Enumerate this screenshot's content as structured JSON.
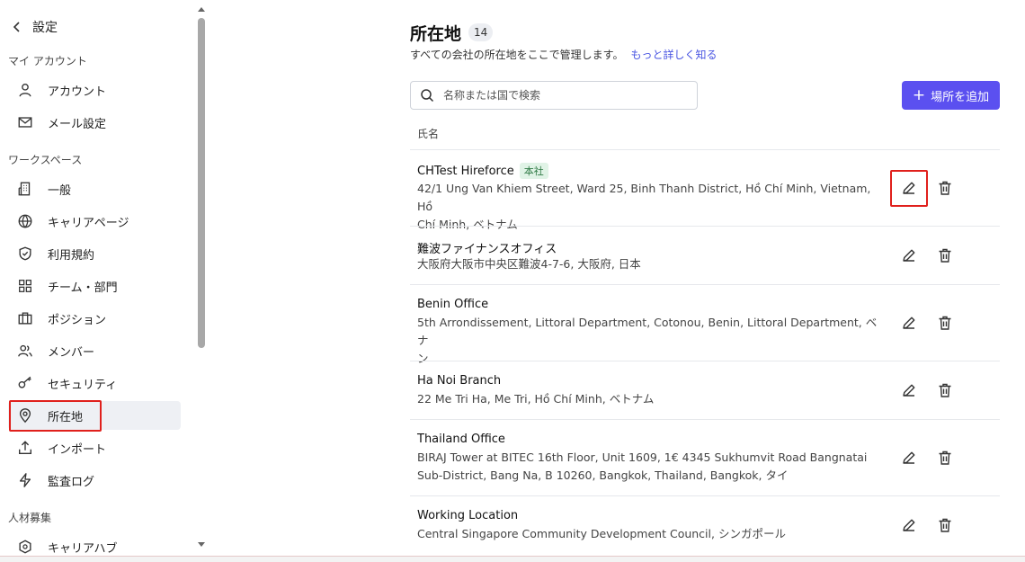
{
  "sidebar": {
    "back_label": "設定",
    "sections": [
      {
        "title": "マイ アカウント",
        "items": [
          {
            "label": "アカウント",
            "icon": "user-icon"
          },
          {
            "label": "メール設定",
            "icon": "mail-icon"
          }
        ]
      },
      {
        "title": "ワークスペース",
        "items": [
          {
            "label": "一般",
            "icon": "building-icon"
          },
          {
            "label": "キャリアページ",
            "icon": "globe-icon"
          },
          {
            "label": "利用規約",
            "icon": "shield-check-icon"
          },
          {
            "label": "チーム・部門",
            "icon": "grid-icon"
          },
          {
            "label": "ポジション",
            "icon": "briefcase-icon"
          },
          {
            "label": "メンバー",
            "icon": "users-icon"
          },
          {
            "label": "セキュリティ",
            "icon": "key-icon"
          },
          {
            "label": "所在地",
            "icon": "map-pin-icon",
            "active": true
          },
          {
            "label": "インポート",
            "icon": "upload-icon"
          },
          {
            "label": "監査ログ",
            "icon": "lightning-icon"
          }
        ]
      },
      {
        "title": "人材募集",
        "items": [
          {
            "label": "キャリアハブ",
            "icon": "hub-icon"
          }
        ]
      }
    ]
  },
  "main": {
    "title": "所在地",
    "count": "14",
    "subtitle": "すべての会社の所在地をここで管理します。",
    "learn_more": "もっと詳しく知る",
    "search_placeholder": "名称または国で検索",
    "add_button": "場所を追加",
    "column_name": "氏名",
    "locations": [
      {
        "name": "CHTest Hireforce",
        "tag": "本社",
        "address_lines": [
          "42/1 Ung Van Khiem Street, Ward 25, Binh Thanh District, Hồ Chí Minh, Vietnam, Hồ",
          "Chí Minh, ベトナム"
        ]
      },
      {
        "name": "難波ファイナンスオフィス",
        "tag": "",
        "address_lines": [
          "大阪府大阪市中央区難波4-7-6, 大阪府, 日本"
        ]
      },
      {
        "name": "Benin Office",
        "tag": "",
        "address_lines": [
          "5th Arrondissement, Littoral Department, Cotonou, Benin, Littoral Department, ベナ",
          "ン"
        ]
      },
      {
        "name": "Ha Noi Branch",
        "tag": "",
        "address_lines": [
          "22 Me Tri Ha, Me Tri, Hồ Chí Minh, ベトナム"
        ]
      },
      {
        "name": "Thailand Office",
        "tag": "",
        "address_lines": [
          "BIRAJ Tower at BITEC 16th Floor, Unit 1609, 1€ 4345 Sukhumvit Road Bangnatai",
          "Sub-District, Bang Na, B 10260, Bangkok, Thailand, Bangkok, タイ"
        ]
      },
      {
        "name": "Working Location",
        "tag": "",
        "address_lines": [
          "Central Singapore Community Development Council, シンガポール"
        ]
      }
    ]
  },
  "colors": {
    "accent": "#5b50f0",
    "link": "#4a56e2",
    "highlight": "#e0201c",
    "tag_bg": "#e0f3e6"
  }
}
